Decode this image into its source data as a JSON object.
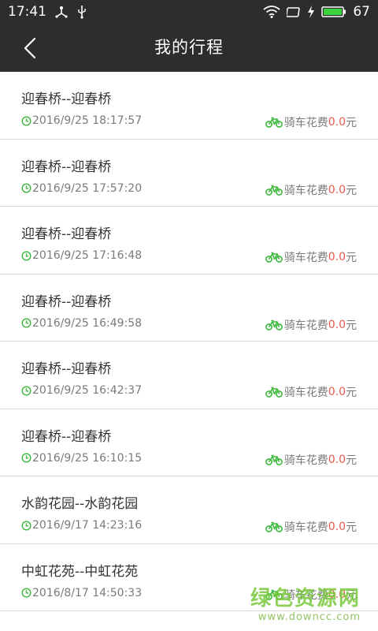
{
  "statusbar": {
    "time": "17:41",
    "battery": "67",
    "icons": [
      "usb-share-icon",
      "usb-icon",
      "wifi-icon",
      "screen-icon",
      "charging-icon",
      "battery-icon"
    ]
  },
  "header": {
    "title": "我的行程",
    "back_icon": "back-arrow-icon"
  },
  "trips": [
    {
      "route": "迎春桥--迎春桥",
      "time": "2016/9/25 18:17:57",
      "cost_label": "骑车花费",
      "cost": "0.0",
      "unit": "元"
    },
    {
      "route": "迎春桥--迎春桥",
      "time": "2016/9/25 17:57:20",
      "cost_label": "骑车花费",
      "cost": "0.0",
      "unit": "元"
    },
    {
      "route": "迎春桥--迎春桥",
      "time": "2016/9/25 17:16:48",
      "cost_label": "骑车花费",
      "cost": "0.0",
      "unit": "元"
    },
    {
      "route": "迎春桥--迎春桥",
      "time": "2016/9/25 16:49:58",
      "cost_label": "骑车花费",
      "cost": "0.0",
      "unit": "元"
    },
    {
      "route": "迎春桥--迎春桥",
      "time": "2016/9/25 16:42:37",
      "cost_label": "骑车花费",
      "cost": "0.0",
      "unit": "元"
    },
    {
      "route": "迎春桥--迎春桥",
      "time": "2016/9/25 16:10:15",
      "cost_label": "骑车花费",
      "cost": "0.0",
      "unit": "元"
    },
    {
      "route": "水韵花园--水韵花园",
      "time": "2016/9/17 14:23:16",
      "cost_label": "骑车花费",
      "cost": "0.0",
      "unit": "元"
    },
    {
      "route": "中虹花苑--中虹花苑",
      "time": "2016/8/17 14:50:33",
      "cost_label": "骑车花费",
      "cost": "0.0",
      "unit": "元"
    }
  ],
  "colors": {
    "header_bg": "#2b2d2f",
    "accent_green": "#3cb83c",
    "cost_red": "#e85a4f"
  },
  "watermark": {
    "cn": "绿色资源网",
    "en": "www.downcc.com"
  }
}
